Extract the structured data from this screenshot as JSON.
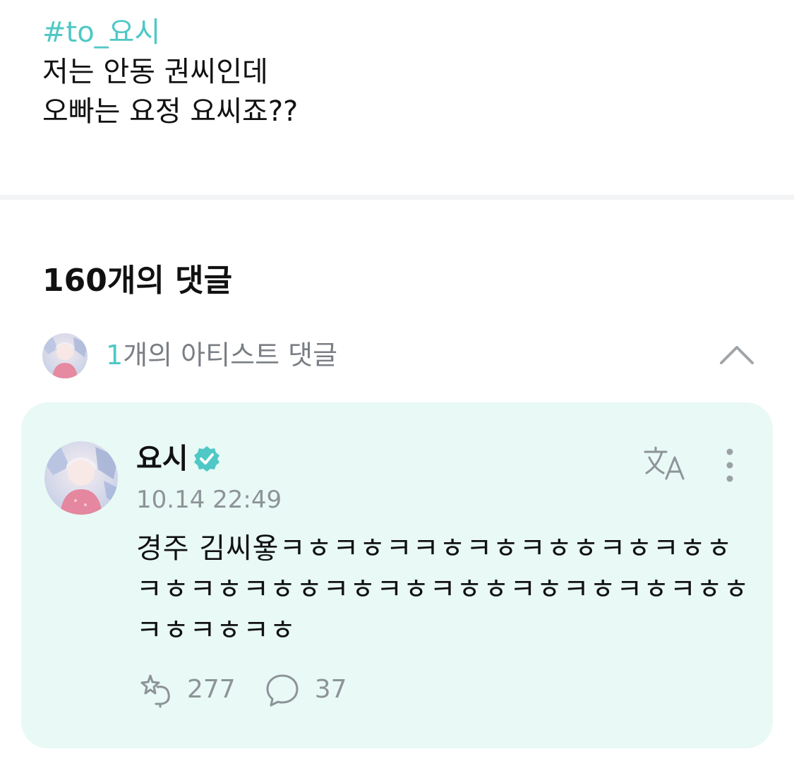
{
  "post": {
    "hashtag": "#to_요시",
    "lines": [
      "저는 안동 권씨인데",
      "오빠는 요정 요씨죠??"
    ]
  },
  "comments_header": {
    "title": "160개의 댓글"
  },
  "artist_comments": {
    "count": "1",
    "label": "개의 아티스트 댓글",
    "expanded": true
  },
  "comment": {
    "author": "요시",
    "verified": true,
    "timestamp": "10.14 22:49",
    "text": "경주 김씨욯ㅋㅎㅋㅎㅋㅋㅎㅋㅎㅋㅎㅎㅋㅎㅋㅎㅎㅋㅎㅋㅎㅋㅎㅎㅋㅎㅋㅎㅋㅎㅎㅋㅎㅋㅎㅋㅎㅋㅎㅎㅋㅎㅋㅎㅋㅎ",
    "likes": "277",
    "replies": "37"
  },
  "colors": {
    "accent": "#4fc8c6",
    "card_background": "#e8f9f6",
    "divider": "#f3f4f5",
    "muted_text": "#8d9398"
  },
  "icons": {
    "collapse": "chevron-up-icon",
    "verified": "verified-badge-icon",
    "translate": "translate-icon",
    "more": "more-vertical-icon",
    "like": "like-sparkle-icon",
    "reply": "speech-bubble-icon"
  }
}
